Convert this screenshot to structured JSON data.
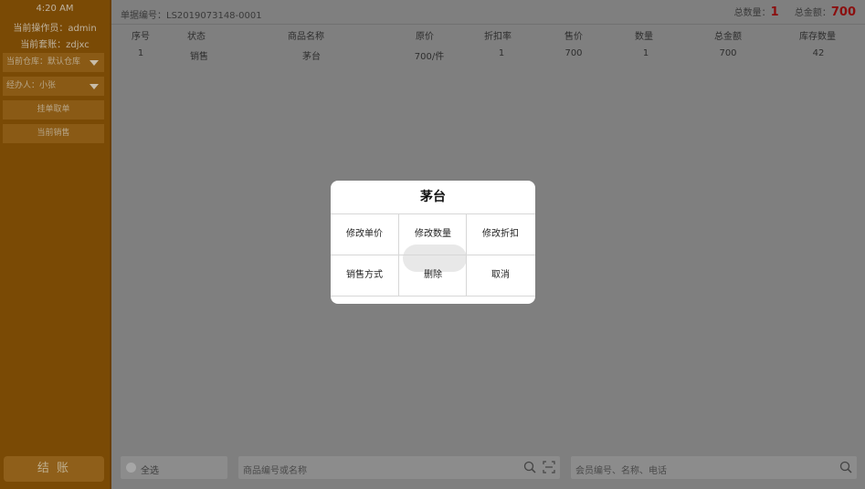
{
  "sidebar": {
    "time": "4:20 AM",
    "operator": "当前操作员：admin",
    "account": "当前套账：zdjxc",
    "warehouse_select": "当前仓库：默认仓库",
    "handler_select": "经办人：小张",
    "btn_hang": "挂单取单",
    "btn_current": "当前销售",
    "btn_checkout": "结 账"
  },
  "header": {
    "bill_no": "单据编号：LS2019073148-0001",
    "total_qty_label": "总数量：",
    "total_qty": "1",
    "total_amount_label": "总金额：",
    "total_amount": "700"
  },
  "table": {
    "columns": [
      "序号",
      "状态",
      "商品名称",
      "原价",
      "折扣率",
      "售价",
      "数量",
      "总金额",
      "库存数量"
    ],
    "rows": [
      [
        "1",
        "销售",
        "茅台",
        "700/件",
        "1",
        "700",
        "1",
        "700",
        "42"
      ]
    ]
  },
  "footer": {
    "select_all": "全选",
    "product_search_placeholder": "商品编号或名称",
    "member_search_placeholder": "会员编号、名称、电话"
  },
  "dialog": {
    "title": "茅台",
    "buttons": [
      "修改单价",
      "修改数量",
      "修改折扣",
      "销售方式",
      "删除",
      "取消"
    ]
  },
  "colors": {
    "sidebar": "#7a4a05",
    "total_highlight": "#8b0f0f",
    "dialog_bg": "#ffffff"
  },
  "icons": [
    "search-icon",
    "scan-icon",
    "dropdown-caret-icon"
  ]
}
